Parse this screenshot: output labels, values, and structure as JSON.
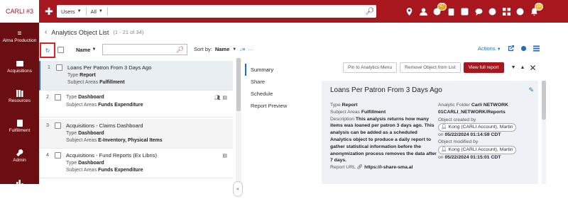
{
  "header": {
    "logo": "CARLI #3",
    "search": {
      "scope": "Users",
      "filter": "All",
      "placeholder": ""
    },
    "badges": {
      "tasks": "47",
      "notifications": "10"
    }
  },
  "nav": [
    {
      "label": "Alma Production",
      "icon": "alma-icon"
    },
    {
      "label": "Acquisitions",
      "icon": "acquisitions-icon"
    },
    {
      "label": "Resources",
      "icon": "resources-icon"
    },
    {
      "label": "Fulfillment",
      "icon": "fulfillment-icon"
    },
    {
      "label": "Admin",
      "icon": "admin-icon"
    },
    {
      "label": "Analytics",
      "icon": "analytics-icon"
    }
  ],
  "page": {
    "title": "Analytics Object List",
    "count": "(1 - 21 of 34)"
  },
  "toolbar": {
    "filter_field": "Name",
    "sort_label": "Sort by:",
    "sort_value": "Name",
    "actions": "Actions"
  },
  "rows": [
    {
      "num": "1",
      "title": "Loans Per Patron From 3 Days Ago",
      "type_k": "Type",
      "type_v": "Report",
      "sa_k": "Subject Areas",
      "sa_v": "Fulfillment"
    },
    {
      "num": "2",
      "title": "",
      "type_k": "Type",
      "type_v": "Dashboard",
      "sa_k": "Subject Areas",
      "sa_v": "Funds Expenditure"
    },
    {
      "num": "3",
      "title": "Acquisitions - Claims Dashboard",
      "type_k": "Type",
      "type_v": "Dashboard",
      "sa_k": "Subject Areas",
      "sa_v": "E-Inventory, Physical Items"
    },
    {
      "num": "4",
      "title": "Acquisitions - Fund Reports (Ex Libris)",
      "type_k": "Type",
      "type_v": "Dashboard",
      "sa_k": "Subject Areas",
      "sa_v": "Funds Expenditure"
    }
  ],
  "detail": {
    "tabs": [
      "Summary",
      "Share",
      "Schedule",
      "Report Preview"
    ],
    "buttons": {
      "pin": "Pin to Analytics Menu",
      "remove": "Remove Object from List",
      "view": "View full report"
    },
    "title": "Loans Per Patron From 3 Days Ago",
    "type_k": "Type",
    "type_v": "Report",
    "sa_k": "Subject Areas",
    "sa_v": "Fulfillment",
    "desc_k": "Description",
    "desc_v": "This analysis returns how many items was loaned per patron 3 days ago. This analysis can be added as a scheduled Analytics object to produce a daily report to gather statistical information before the anonymization process removes the data after 7 days.",
    "url_k": "Report URL",
    "url_v": "https://i-share-sma.al",
    "folder_k": "Analytic Folder",
    "folder_v": "Carli NETWORK 01CARLI_NETWORK/Reports",
    "created_k": "Object created by",
    "created_by": "Kong (CARLI Account), Martin",
    "created_on_k": "on",
    "created_on": "05/22/2024 01:14:59 CDT",
    "modified_k": "Object modified by",
    "modified_by": "Kong (CARLI Account), Martin",
    "modified_on_k": "on",
    "modified_on": "05/22/2024 01:15:01 CDT"
  }
}
